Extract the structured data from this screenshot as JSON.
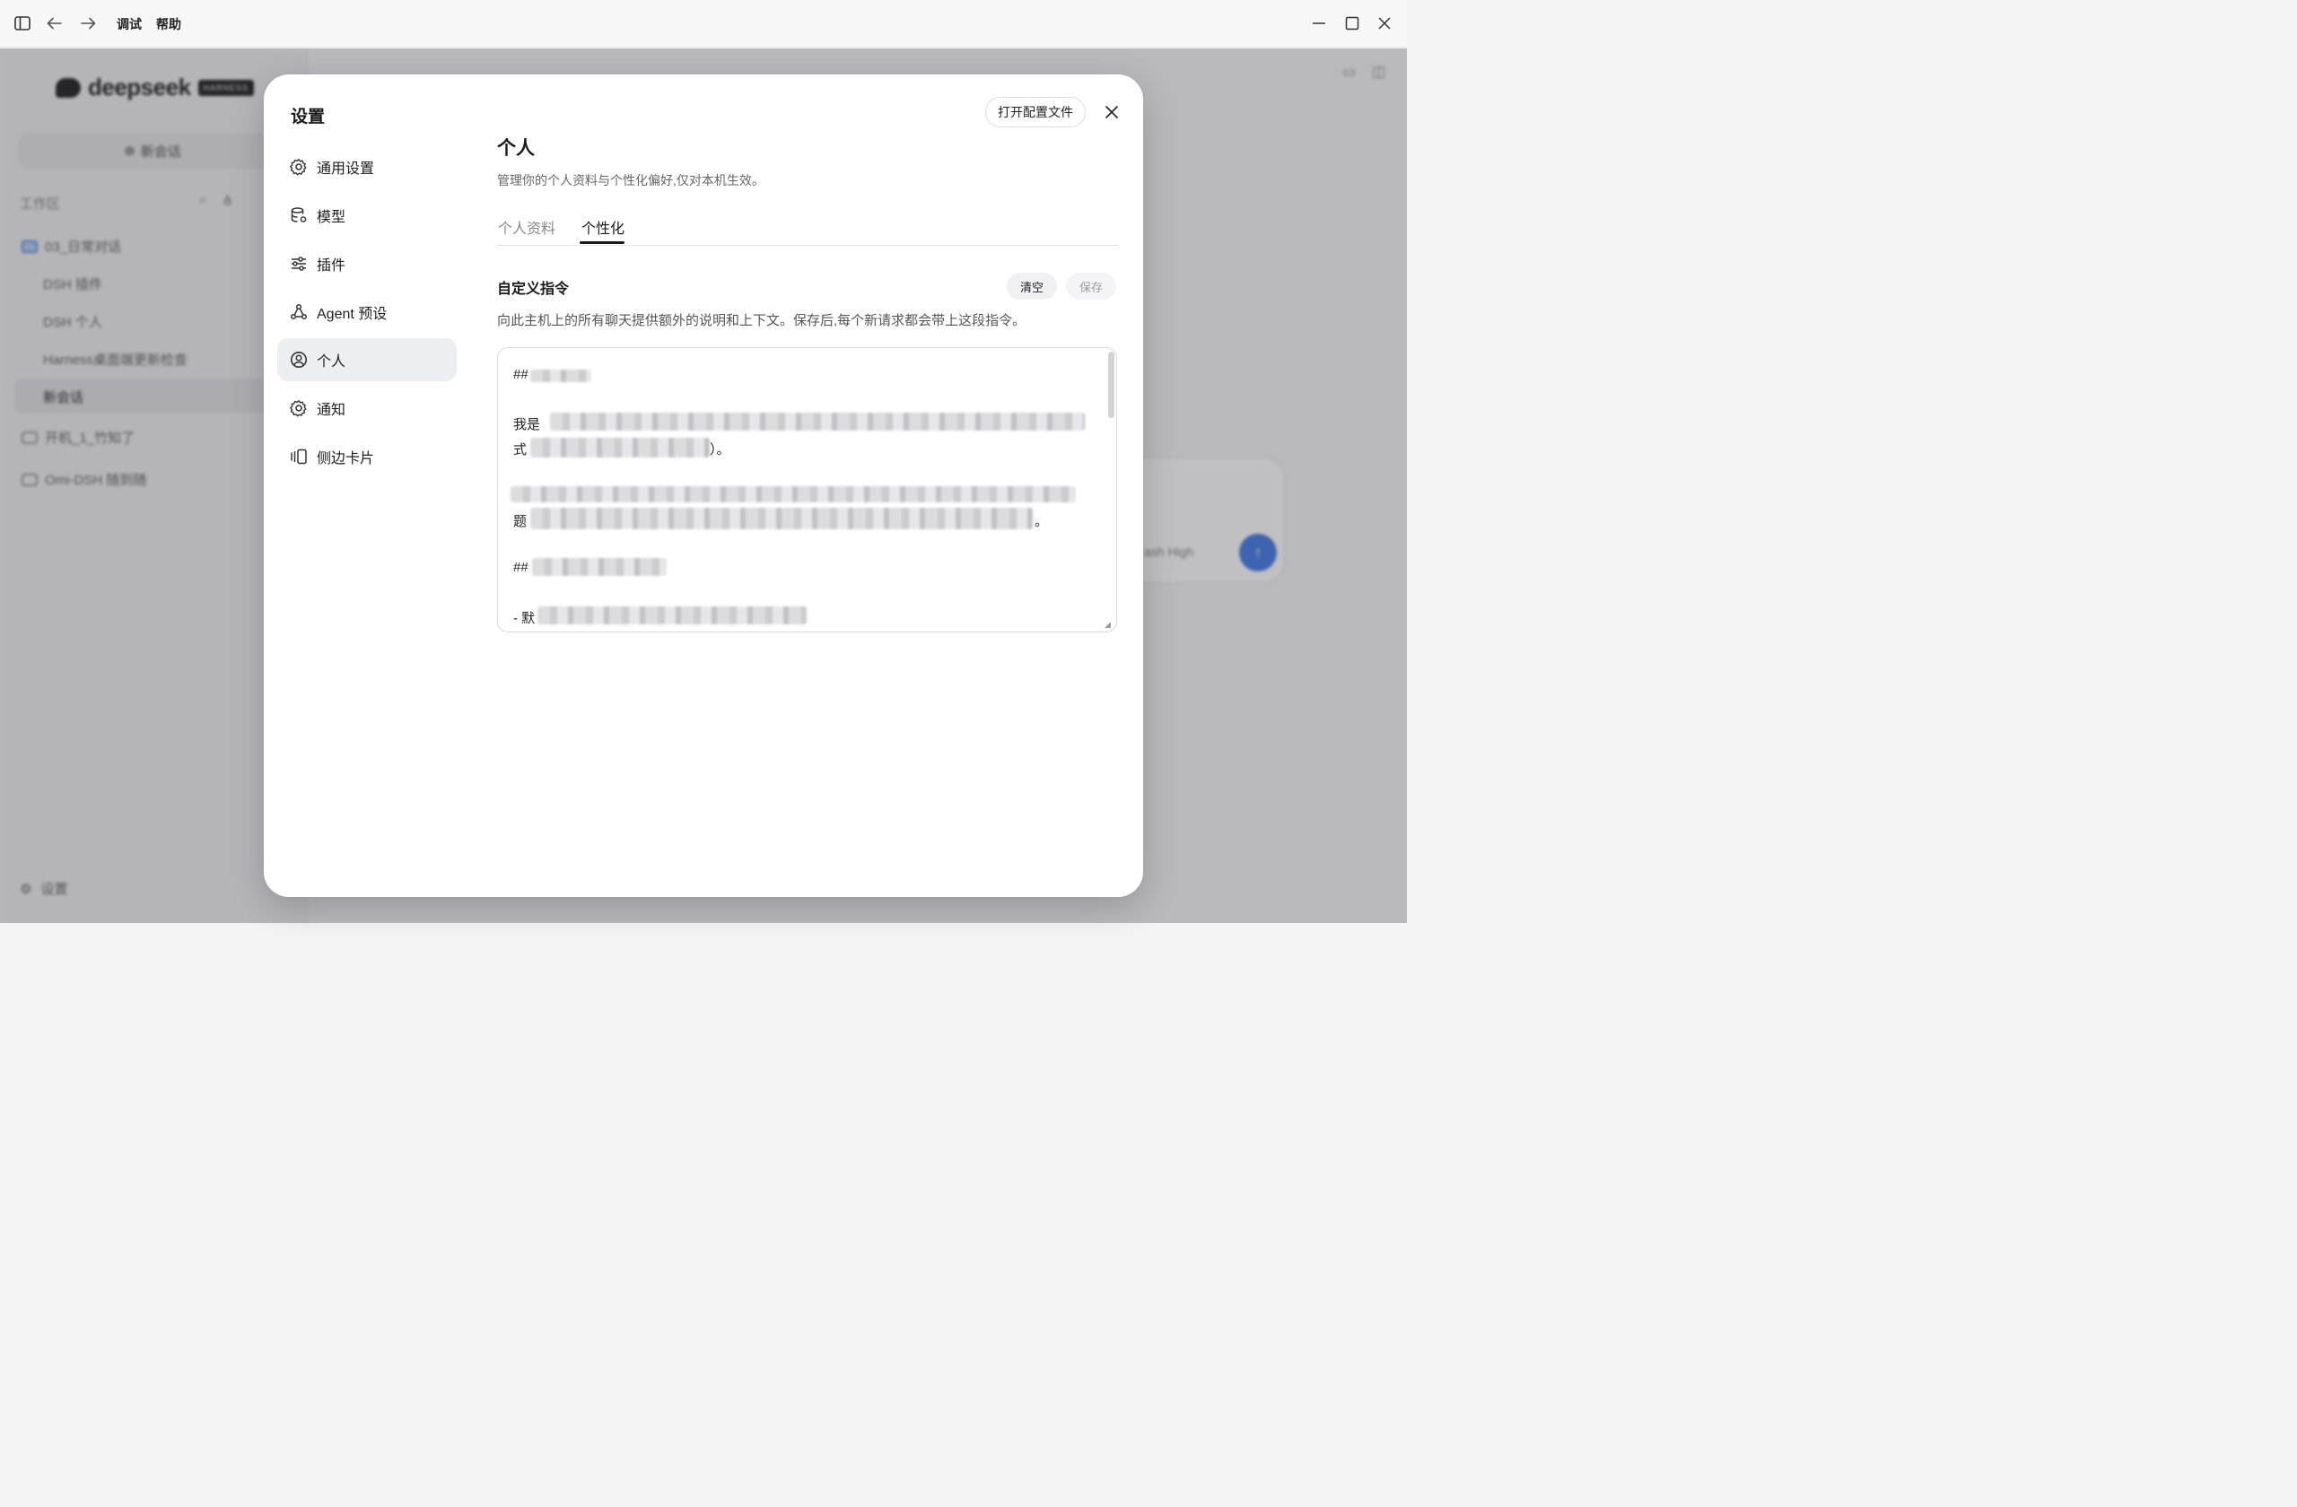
{
  "titlebar": {
    "menu": [
      "调试",
      "帮助"
    ]
  },
  "background_app": {
    "brand": "deepseek",
    "brand_badge": "HARNESS",
    "new_chat": "新会话",
    "workspace_label": "工作区",
    "tree": [
      {
        "label": "03_日常对话",
        "type": "folder-open"
      },
      {
        "label": "DSH 插件",
        "type": "item"
      },
      {
        "label": "DSH 个人",
        "type": "item"
      },
      {
        "label": "Harness桌面端更新检查",
        "type": "item"
      },
      {
        "label": "新会话",
        "type": "item-selected"
      },
      {
        "label": "开机_1_竹知了",
        "type": "folder"
      },
      {
        "label": "Omi-DSH 随到随",
        "type": "folder"
      }
    ],
    "settings_label": "设置",
    "composer_model": "ash High"
  },
  "modal": {
    "title": "设置",
    "nav": [
      {
        "label": "通用设置",
        "icon": "gear-icon"
      },
      {
        "label": "模型",
        "icon": "database-gear-icon"
      },
      {
        "label": "插件",
        "icon": "sliders-icon"
      },
      {
        "label": "Agent 预设",
        "icon": "agent-nodes-icon"
      },
      {
        "label": "个人",
        "icon": "user-circle-icon",
        "active": true
      },
      {
        "label": "通知",
        "icon": "gear-icon"
      },
      {
        "label": "侧边卡片",
        "icon": "side-cards-icon"
      }
    ],
    "open_config": "打开配置文件",
    "section_title": "个人",
    "section_desc": "管理你的个人资料与个性化偏好,仅对本机生效。",
    "tabs": [
      {
        "label": "个人资料",
        "active": false
      },
      {
        "label": "个性化",
        "active": true
      }
    ],
    "custom_instructions": {
      "title": "自定义指令",
      "clear": "清空",
      "save": "保存",
      "desc": "向此主机上的所有聊天提供额外的说明和上下文。保存后,每个新请求都会带上这段指令。",
      "lines": [
        "##",
        "我是",
        "式",
        "）。",
        "题",
        "。",
        "##",
        "- 默"
      ]
    }
  }
}
